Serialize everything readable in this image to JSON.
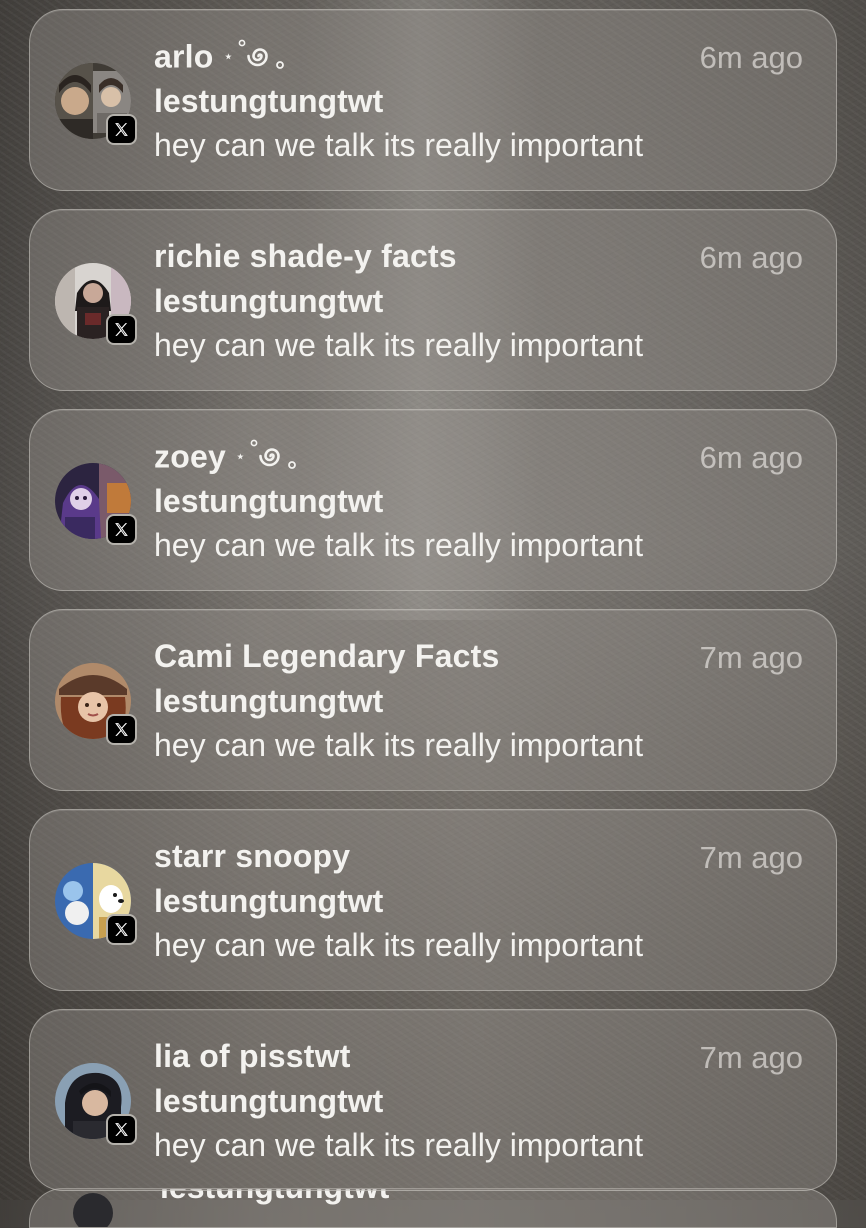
{
  "notifications": [
    {
      "title": "arlo",
      "title_decoration": "⋆˚🌀｡",
      "time": "6m ago",
      "subtitle": "lestungtungtwt",
      "message": "hey can we talk its really important",
      "avatar_icon": "avatar-arlo",
      "app_icon": "x-app-icon"
    },
    {
      "title": "richie shade-y facts",
      "title_decoration": "",
      "time": "6m ago",
      "subtitle": "lestungtungtwt",
      "message": "hey can we talk its really important",
      "avatar_icon": "avatar-richie",
      "app_icon": "x-app-icon"
    },
    {
      "title": "zoey",
      "title_decoration": "⋆˚🌀｡",
      "time": "6m ago",
      "subtitle": "lestungtungtwt",
      "message": "hey can we talk its really important",
      "avatar_icon": "avatar-zoey",
      "app_icon": "x-app-icon"
    },
    {
      "title": "Cami Legendary Facts",
      "title_decoration": "",
      "time": "7m ago",
      "subtitle": "lestungtungtwt",
      "message": "hey can we talk its really important",
      "avatar_icon": "avatar-cami",
      "app_icon": "x-app-icon"
    },
    {
      "title": "starr snoopy",
      "title_decoration": "",
      "time": "7m ago",
      "subtitle": "lestungtungtwt",
      "message": "hey can we talk its really important",
      "avatar_icon": "avatar-starr",
      "app_icon": "x-app-icon"
    },
    {
      "title": "lia of pisstwt",
      "title_decoration": "",
      "time": "7m ago",
      "subtitle": "lestungtungtwt",
      "message": "hey can we talk its really important",
      "avatar_icon": "avatar-lia",
      "app_icon": "x-app-icon"
    }
  ],
  "peek_notification": {
    "subtitle": "lestungtungtwt"
  },
  "colors": {
    "card_bg": "#96928c",
    "text_primary": "#f3f2ef",
    "text_secondary": "#b8b5b0",
    "badge_bg": "#000000"
  }
}
